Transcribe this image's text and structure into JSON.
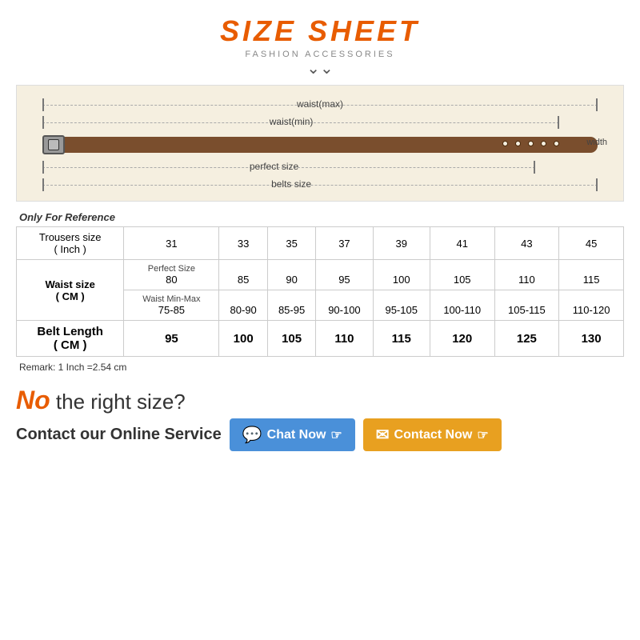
{
  "title": {
    "main": "SIZE SHEET",
    "subtitle": "FASHION ACCESSORIES",
    "chevron": "❯❯"
  },
  "belt_diagram": {
    "labels": {
      "waist_max": "waist(max)",
      "waist_min": "waist(min)",
      "perfect_size": "perfect size",
      "belts_size": "belts size",
      "width": "width"
    }
  },
  "reference_note": "Only For Reference",
  "table": {
    "headers": {
      "trousers_size": "Trousers size",
      "inch": "( Inch )",
      "sizes": [
        "31",
        "33",
        "35",
        "37",
        "39",
        "41",
        "43",
        "45"
      ]
    },
    "waist_section": {
      "label": "Waist size",
      "unit": "( CM )",
      "perfect_label": "Perfect Size",
      "perfect_values": [
        "80",
        "85",
        "90",
        "95",
        "100",
        "105",
        "110",
        "115"
      ],
      "waist_label": "Waist Min-Max",
      "waist_values": [
        "75-85",
        "80-90",
        "85-95",
        "90-100",
        "95-105",
        "100-110",
        "105-115",
        "110-120"
      ]
    },
    "belt_length": {
      "label": "Belt Length",
      "unit": "( CM )",
      "values": [
        "95",
        "100",
        "105",
        "110",
        "115",
        "120",
        "125",
        "130"
      ]
    }
  },
  "remark": "Remark: 1 Inch =2.54 cm",
  "bottom": {
    "no_size_question": "the right size?",
    "no_word": "No",
    "contact_label": "Contact our Online Service",
    "chat_btn": "Chat Now",
    "contact_btn": "Contact Now"
  }
}
